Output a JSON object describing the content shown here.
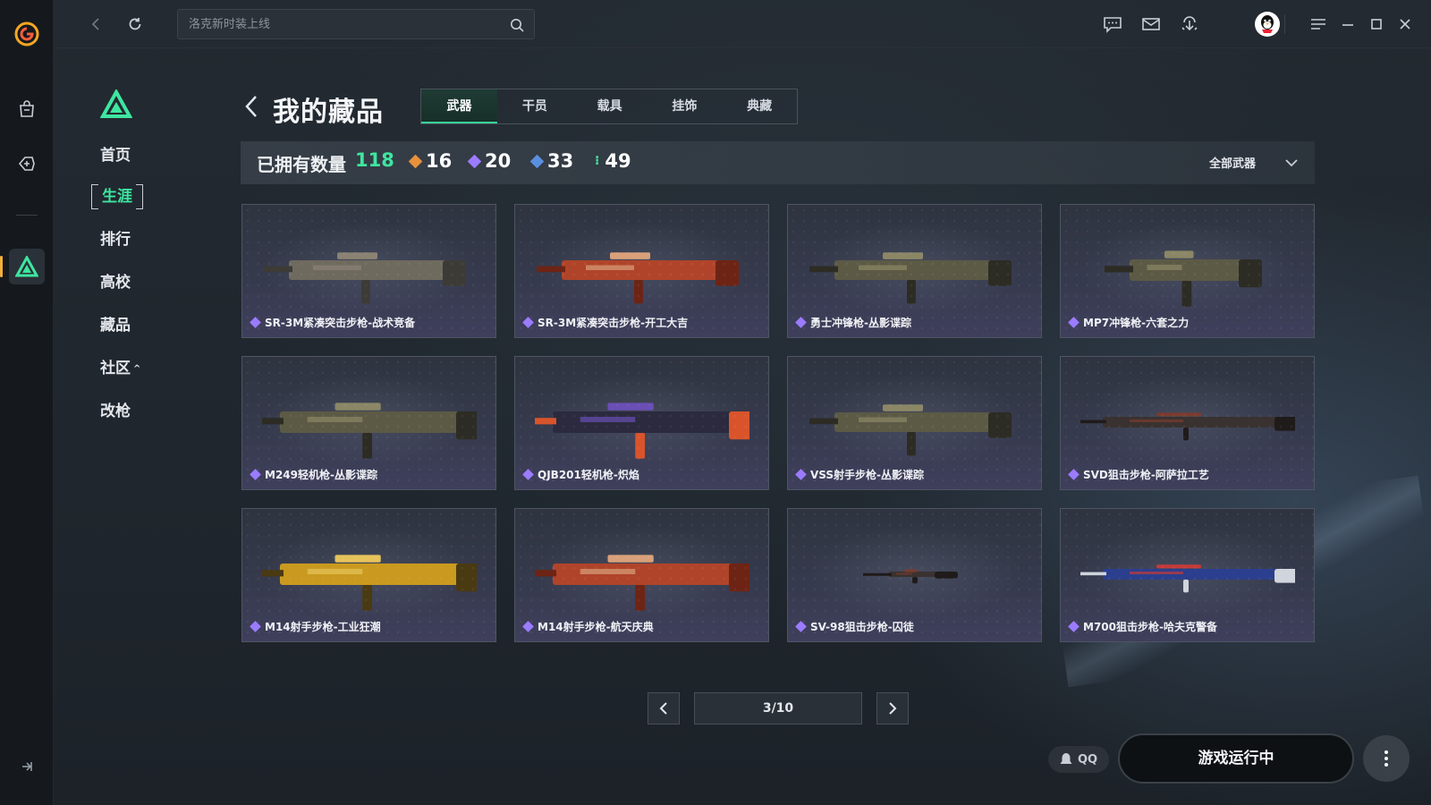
{
  "topbar": {
    "search_placeholder": "洛克新时装上线"
  },
  "sidemenu": {
    "items": [
      "首页",
      "生涯",
      "排行",
      "高校",
      "藏品",
      "社区",
      "改枪"
    ],
    "active": "生涯"
  },
  "page": {
    "title": "我的藏品",
    "tabs": [
      "武器",
      "干员",
      "载具",
      "挂饰",
      "典藏"
    ],
    "active_tab": "武器"
  },
  "stats": {
    "label": "已拥有数量",
    "total": "118",
    "rarity_counts": [
      {
        "value": "16",
        "color": "#e8913b"
      },
      {
        "value": "20",
        "color": "#9b7bff"
      },
      {
        "value": "33",
        "color": "#5a8fe0"
      },
      {
        "value": "49",
        "color": "#3ee6a0"
      }
    ],
    "filter_label": "全部武器"
  },
  "items": [
    {
      "name": "SR-3M紧凑突击步枪-战术竞备",
      "finish": "tactical",
      "size": "rifle"
    },
    {
      "name": "SR-3M紧凑突击步枪-开工大吉",
      "finish": "red",
      "size": "rifle"
    },
    {
      "name": "勇士冲锋枪-丛影谍踪",
      "finish": "camo",
      "size": "rifle"
    },
    {
      "name": "MP7冲锋枪-六套之力",
      "finish": "camo",
      "size": "smg"
    },
    {
      "name": "M249轻机枪-丛影谍踪",
      "finish": "camo",
      "size": "lmg"
    },
    {
      "name": "QJB201轻机枪-炽焰",
      "finish": "flame",
      "size": "lmg"
    },
    {
      "name": "VSS射手步枪-丛影谍踪",
      "finish": "camo",
      "size": "rifle"
    },
    {
      "name": "SVD狙击步枪-阿萨拉工艺",
      "finish": "dark",
      "size": "sniper"
    },
    {
      "name": "M14射手步枪-工业狂潮",
      "finish": "gold",
      "size": "lmg"
    },
    {
      "name": "M14射手步枪-航天庆典",
      "finish": "red",
      "size": "lmg"
    },
    {
      "name": "SV-98狙击步枪-囚徒",
      "finish": "dark",
      "size": "tiny"
    },
    {
      "name": "M700狙击步枪-哈夫克警备",
      "finish": "flag",
      "size": "sniper"
    }
  ],
  "pager": {
    "current": "3/10"
  },
  "bottom": {
    "qq_label": "QQ",
    "run_label": "游戏运行中"
  },
  "colors": {
    "accent": "#3ee6a0",
    "rarity_purple": "#9b7bff"
  }
}
